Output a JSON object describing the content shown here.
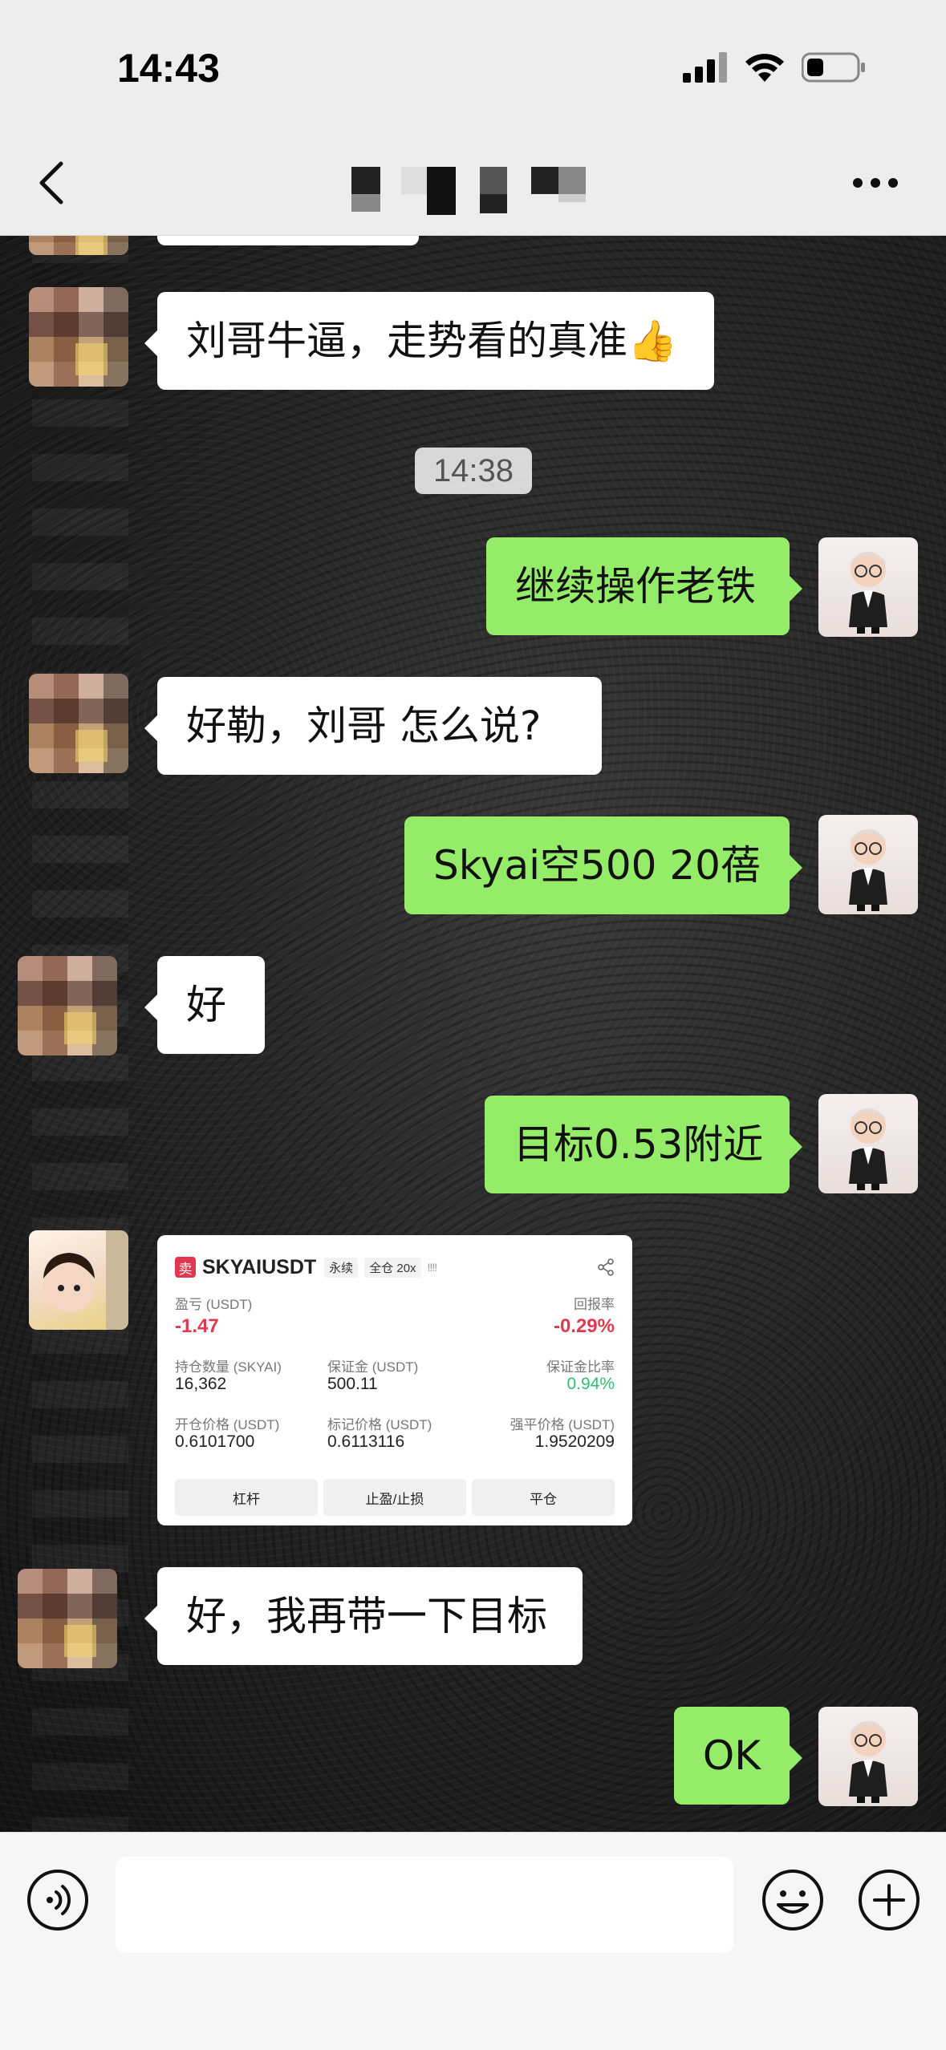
{
  "status_bar": {
    "time": "14:43"
  },
  "nav": {
    "title": ""
  },
  "chat": {
    "timestamp": "14:38",
    "messages": [
      {
        "side": "left",
        "text": "刘哥牛逼，走势看的真准👍"
      },
      {
        "side": "right",
        "text": "继续操作老铁"
      },
      {
        "side": "left",
        "text": "好勒，刘哥  怎么说?"
      },
      {
        "side": "right",
        "text": "Skyai空500  20蓓"
      },
      {
        "side": "left",
        "text": "好"
      },
      {
        "side": "right",
        "text": "目标0.53附近"
      },
      {
        "side": "left",
        "text": "好，我再带一下目标"
      },
      {
        "side": "right",
        "text": "OK"
      }
    ]
  },
  "trade_card": {
    "sell_badge": "卖",
    "symbol": "SKYAIUSDT",
    "tag_perpetual": "永续",
    "tag_margin": "全仓 20x",
    "bars": "!!!!",
    "pnl_label": "盈亏 (USDT)",
    "pnl_value": "-1.47",
    "roe_label": "回报率",
    "roe_value": "-0.29%",
    "size_label": "持仓数量 (SKYAI)",
    "size_value": "16,362",
    "margin_label": "保证金 (USDT)",
    "margin_value": "500.11",
    "margin_ratio_label": "保证金比率",
    "margin_ratio_value": "0.94%",
    "entry_label": "开仓价格 (USDT)",
    "entry_value": "0.6101700",
    "mark_label": "标记价格 (USDT)",
    "mark_value": "0.6113116",
    "liq_label": "强平价格 (USDT)",
    "liq_value": "1.9520209",
    "btn_leverage": "杠杆",
    "btn_tpsl": "止盈/止损",
    "btn_close": "平仓"
  },
  "input_bar": {
    "placeholder": ""
  },
  "colors": {
    "bubble_right": "#95ec69",
    "bubble_left": "#ffffff",
    "loss_red": "#e0394f",
    "ratio_green": "#2fbf71"
  },
  "icons": [
    "back-icon",
    "more-icon",
    "voice-icon",
    "emoji-icon",
    "plus-icon",
    "share-icon",
    "signal-icon",
    "wifi-icon",
    "battery-icon"
  ]
}
